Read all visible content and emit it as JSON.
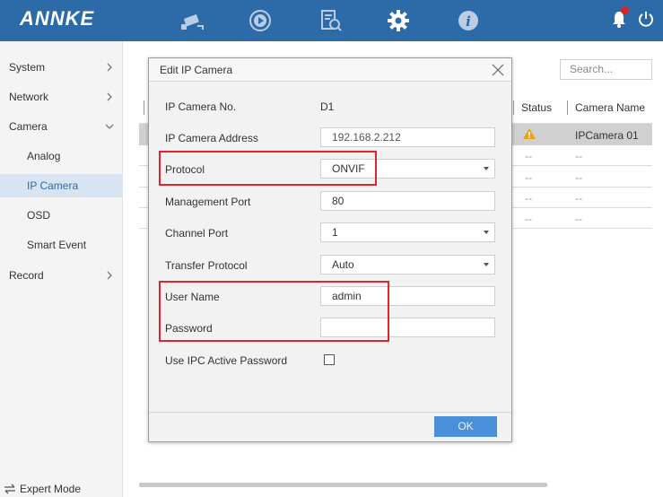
{
  "app": {
    "logo": "ANNKE"
  },
  "nav_icons": [
    "camera-icon",
    "playback-icon",
    "search-file-icon",
    "gear-icon",
    "info-icon"
  ],
  "sidebar": {
    "items": [
      {
        "label": "System"
      },
      {
        "label": "Network"
      },
      {
        "label": "Camera"
      },
      {
        "label": "Analog"
      },
      {
        "label": "IP Camera"
      },
      {
        "label": "OSD"
      },
      {
        "label": "Smart Event"
      },
      {
        "label": "Record"
      }
    ],
    "expert_mode": "Expert Mode"
  },
  "main": {
    "search_placeholder": "Search...",
    "columns": {
      "status": "Status",
      "camera_name": "Camera Name"
    },
    "rows": [
      {
        "status": "warning",
        "camera_name": "IPCamera 01"
      },
      {
        "status": "--",
        "camera_name": "--"
      },
      {
        "status": "--",
        "camera_name": "--"
      },
      {
        "status": "--",
        "camera_name": "--"
      }
    ]
  },
  "dialog": {
    "title": "Edit IP Camera",
    "fields": {
      "camera_no": {
        "label": "IP Camera No.",
        "value": "D1"
      },
      "address": {
        "label": "IP Camera Address",
        "value": "192.168.2.212"
      },
      "protocol": {
        "label": "Protocol",
        "value": "ONVIF"
      },
      "management_port": {
        "label": "Management Port",
        "value": "80"
      },
      "channel_port": {
        "label": "Channel Port",
        "value": "1"
      },
      "transfer_protocol": {
        "label": "Transfer Protocol",
        "value": "Auto"
      },
      "user_name": {
        "label": "User Name",
        "value": "admin"
      },
      "password": {
        "label": "Password",
        "value": ""
      },
      "ipc_active_password": {
        "label": "Use IPC Active Password",
        "checked": false
      }
    },
    "ok_label": "OK"
  },
  "colors": {
    "topbar": "#2d6aa8",
    "accent": "#4a90d9",
    "highlight": "#e0262b"
  }
}
